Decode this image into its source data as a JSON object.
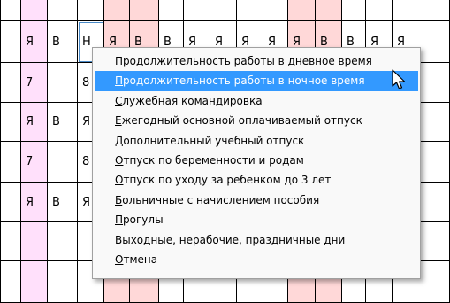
{
  "grid": {
    "rows": [
      {
        "cells": [
          "Я",
          "В",
          "Н",
          "Я",
          "В",
          "В",
          "Я",
          "Я",
          "Я",
          "Я",
          "Я",
          "В",
          "В",
          "Я",
          "Я"
        ]
      },
      {
        "cells": [
          "7",
          "",
          "8",
          "",
          "",
          "",
          "",
          "",
          "",
          "",
          "",
          "",
          "",
          "",
          "8"
        ]
      },
      {
        "cells": [
          "Я",
          "В",
          "Я",
          "",
          "",
          "",
          "",
          "",
          "",
          "",
          "",
          "",
          "",
          "",
          "Я"
        ]
      },
      {
        "cells": [
          "7",
          "",
          "8",
          "",
          "",
          "",
          "",
          "",
          "",
          "",
          "",
          "",
          "",
          "",
          "8"
        ]
      },
      {
        "cells": [
          "Я",
          "В",
          "Я",
          "",
          "",
          "",
          "",
          "",
          "",
          "",
          "",
          "",
          "",
          "",
          "Я"
        ]
      },
      {
        "cells": [
          "",
          "",
          "",
          "",
          "",
          "",
          "",
          "",
          "",
          "",
          "",
          "",
          "",
          "",
          ""
        ]
      }
    ]
  },
  "context_menu": {
    "items": [
      {
        "accel": "П",
        "rest": "родолжительность работы в дневное время"
      },
      {
        "accel": "П",
        "rest": "родолжительность работы в ночное время"
      },
      {
        "accel": "С",
        "rest": "лужебная командировка"
      },
      {
        "accel": "Е",
        "rest": "жегодный основной оплачиваемый отпуск"
      },
      {
        "accel": "Д",
        "rest": "ополнительный учебный отпуск"
      },
      {
        "accel": "О",
        "rest": "тпуск по беременности и родам"
      },
      {
        "accel": "О",
        "rest": "тпуск по уходу за ребенком до 3 лет"
      },
      {
        "accel": "Б",
        "rest": "ольничные с начислением пособия"
      },
      {
        "accel": "П",
        "rest": "рогулы"
      },
      {
        "accel": "В",
        "rest": "ыходные, нерабочие, праздничные дни"
      },
      {
        "accel": "О",
        "rest": "тмена"
      }
    ],
    "highlighted_index": 1
  },
  "colors": {
    "weekend_column": "#ffe0fb",
    "holiday_column": "#ffd8d8",
    "menu_highlight": "#3399ff"
  },
  "icons": {
    "cursor": "mouse-pointer-icon"
  }
}
